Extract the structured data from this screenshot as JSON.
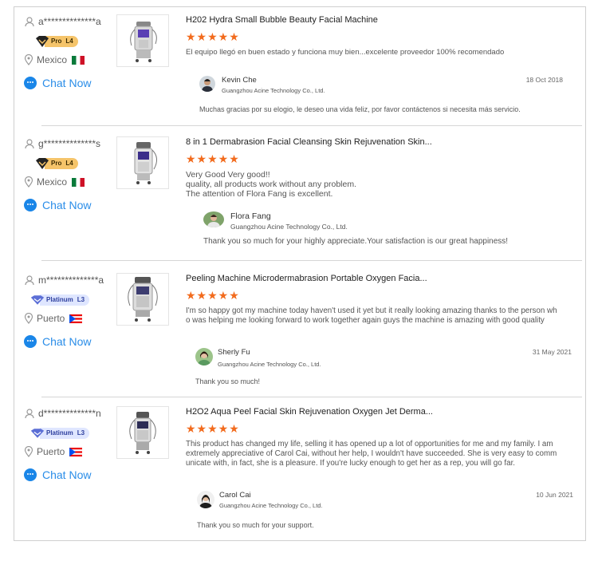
{
  "reviews": [
    {
      "user": "a**************a",
      "badge": {
        "name": "Pro",
        "level": "L4"
      },
      "location": "Mexico",
      "chat": "Chat Now",
      "product": "H202 Hydra Small Bubble Beauty Facial Machine",
      "stars": "★★★★★",
      "review": "El equipo llegó en buen estado y funciona muy bien...excelente proveedor 100% recomendado",
      "reply": {
        "name": "Kevin Che",
        "company": "Guangzhou Acine Technology Co., Ltd.",
        "date": "18 Oct 2018",
        "message": "Muchas gracias por su elogio, le deseo una vida feliz, por favor contáctenos si necesita más servicio."
      }
    },
    {
      "user": "g**************s",
      "badge": {
        "name": "Pro",
        "level": "L4"
      },
      "location": "Mexico",
      "chat": "Chat Now",
      "product": "8 in 1 Dermabrasion Facial Cleansing Skin Rejuvenation Skin...",
      "stars": "★★★★★",
      "review": "Very Good Very good!!\nquality, all products work without any problem.\nThe attention of Flora Fang is excellent.",
      "reply": {
        "name": "Flora Fang",
        "company": "Guangzhou Acine Technology Co., Ltd.",
        "date": "",
        "message": "Thank you so much for your highly appreciate.Your satisfaction is our great happiness!"
      }
    },
    {
      "user": "m**************a",
      "badge": {
        "name": "Platinum",
        "level": "L3"
      },
      "location": "Puerto",
      "chat": "Chat Now",
      "product": "Peeling Machine Microdermabrasion Portable Oxygen Facia...",
      "stars": "★★★★★",
      "review": "I'm so happy got my machine today haven't used it yet but it really looking amazing thanks to the person wh\no was helping me looking forward to work together again guys the machine is amazing with good quality",
      "reply": {
        "name": "Sherly Fu",
        "company": "Guangzhou Acine Technology Co., Ltd.",
        "date": "31 May 2021",
        "message": "Thank you so much!"
      }
    },
    {
      "user": "d**************n",
      "badge": {
        "name": "Platinum",
        "level": "L3"
      },
      "location": "Puerto",
      "chat": "Chat Now",
      "product": "H2O2 Aqua Peel Facial Skin Rejuvenation Oxygen Jet Derma...",
      "stars": "★★★★★",
      "review": "This product has changed my life, selling it has opened up a lot of opportunities for me and my family. I am\nextremely appreciative of Carol Cai, without her help, I wouldn't have succeeded. She is very easy to comm\nunicate with, in fact, she is a pleasure. If you're lucky enough to get her as a rep, you will go far.",
      "reply": {
        "name": "Carol Cai",
        "company": "Guangzhou Acine Technology Co., Ltd.",
        "date": "10 Jun 2021",
        "message": "Thank you so much for your support."
      }
    }
  ]
}
